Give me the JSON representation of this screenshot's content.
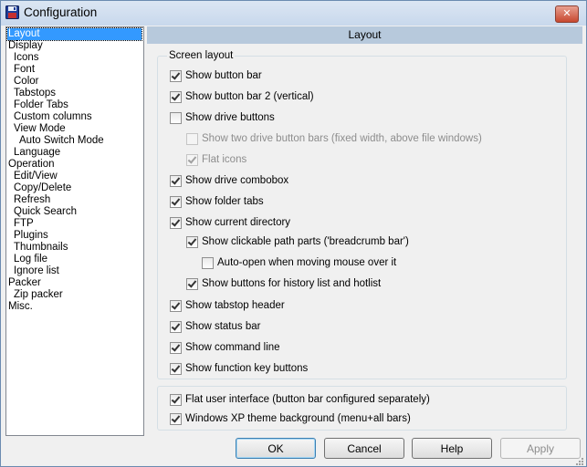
{
  "window": {
    "title": "Configuration",
    "close_label": "✕"
  },
  "tree": {
    "items": [
      {
        "label": "Layout",
        "level": 0,
        "selected": true
      },
      {
        "label": "Display",
        "level": 0
      },
      {
        "label": "Icons",
        "level": 1
      },
      {
        "label": "Font",
        "level": 1
      },
      {
        "label": "Color",
        "level": 1
      },
      {
        "label": "Tabstops",
        "level": 1
      },
      {
        "label": "Folder Tabs",
        "level": 1
      },
      {
        "label": "Custom columns",
        "level": 1
      },
      {
        "label": "View Mode",
        "level": 1
      },
      {
        "label": "Auto Switch Mode",
        "level": 2
      },
      {
        "label": "Language",
        "level": 1
      },
      {
        "label": "Operation",
        "level": 0
      },
      {
        "label": "Edit/View",
        "level": 1
      },
      {
        "label": "Copy/Delete",
        "level": 1
      },
      {
        "label": "Refresh",
        "level": 1
      },
      {
        "label": "Quick Search",
        "level": 1
      },
      {
        "label": "FTP",
        "level": 1
      },
      {
        "label": "Plugins",
        "level": 1
      },
      {
        "label": "Thumbnails",
        "level": 1
      },
      {
        "label": "Log file",
        "level": 1
      },
      {
        "label": "Ignore list",
        "level": 1
      },
      {
        "label": "Packer",
        "level": 0
      },
      {
        "label": "Zip packer",
        "level": 1
      },
      {
        "label": "Misc.",
        "level": 0
      }
    ]
  },
  "panel": {
    "header": "Layout",
    "group_label": "Screen layout",
    "options": [
      {
        "label": "Show button bar",
        "checked": true,
        "indent": 0,
        "enabled": true
      },
      {
        "label": "Show button bar 2 (vertical)",
        "checked": true,
        "indent": 0,
        "enabled": true
      },
      {
        "label": "Show drive buttons",
        "checked": false,
        "indent": 0,
        "enabled": true
      },
      {
        "label": "Show two drive button bars (fixed width, above file windows)",
        "checked": false,
        "indent": 1,
        "enabled": false
      },
      {
        "label": "Flat icons",
        "checked": true,
        "indent": 1,
        "enabled": false
      },
      {
        "label": "Show drive combobox",
        "checked": true,
        "indent": 0,
        "enabled": true
      },
      {
        "label": "Show folder tabs",
        "checked": true,
        "indent": 0,
        "enabled": true
      },
      {
        "label": "Show current directory",
        "checked": true,
        "indent": 0,
        "enabled": true
      },
      {
        "label": "Show clickable path parts ('breadcrumb bar')",
        "checked": true,
        "indent": 1,
        "enabled": true
      },
      {
        "label": "Auto-open when moving mouse over it",
        "checked": false,
        "indent": 2,
        "enabled": true
      },
      {
        "label": "Show buttons for history list and hotlist",
        "checked": true,
        "indent": 1,
        "enabled": true
      },
      {
        "label": "Show tabstop header",
        "checked": true,
        "indent": 0,
        "enabled": true
      },
      {
        "label": "Show status bar",
        "checked": true,
        "indent": 0,
        "enabled": true
      },
      {
        "label": "Show command line",
        "checked": true,
        "indent": 0,
        "enabled": true
      },
      {
        "label": "Show function key buttons",
        "checked": true,
        "indent": 0,
        "enabled": true
      }
    ],
    "extra_options": [
      {
        "label": "Flat user interface (button bar configured separately)",
        "checked": true
      },
      {
        "label": "Windows XP theme background (menu+all bars)",
        "checked": true
      }
    ]
  },
  "buttons": {
    "ok": "OK",
    "cancel": "Cancel",
    "help": "Help",
    "apply": "Apply"
  },
  "colors": {
    "selection": "#3399ff",
    "header_bg": "#b7c9dc"
  }
}
